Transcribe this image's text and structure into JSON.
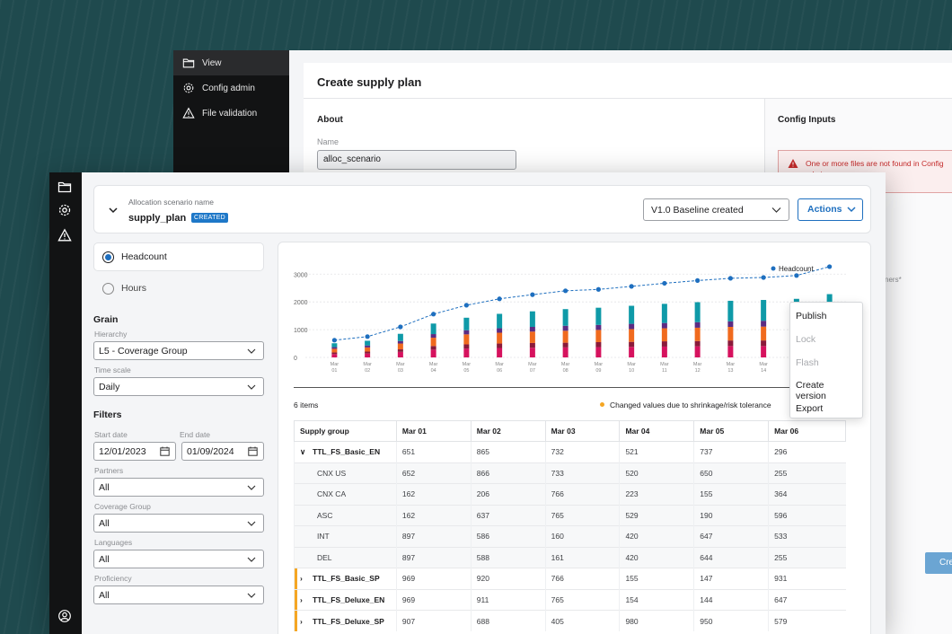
{
  "back_window": {
    "nav": [
      {
        "label": "View",
        "icon": "folder-icon",
        "active": true
      },
      {
        "label": "Config admin",
        "icon": "gear-icon",
        "active": false
      },
      {
        "label": "File validation",
        "icon": "warning-icon",
        "active": false
      }
    ],
    "title": "Create supply plan",
    "about": {
      "heading": "About",
      "name_label": "Name",
      "name_value": "alloc_scenario"
    },
    "config": {
      "heading": "Config Inputs",
      "alert_text": "One or more files are not found in Config admin.",
      "partners_fragment": "ners*",
      "create_button": "Cre"
    }
  },
  "header": {
    "scenario_label": "Allocation scenario name",
    "scenario_name": "supply_plan",
    "status_badge": "CREATED",
    "version_select": "V1.0 Baseline created",
    "actions_label": "Actions"
  },
  "mode": {
    "headcount": "Headcount",
    "hours": "Hours",
    "selected": "headcount"
  },
  "grain": {
    "title": "Grain",
    "hierarchy_label": "Hierarchy",
    "hierarchy_value": "L5 - Coverage Group",
    "time_scale_label": "Time scale",
    "time_scale_value": "Daily"
  },
  "filters": {
    "title": "Filters",
    "start_label": "Start date",
    "start_value": "12/01/2023",
    "end_label": "End date",
    "end_value": "01/09/2024",
    "partners_label": "Partners",
    "partners_value": "All",
    "coverage_label": "Coverage Group",
    "coverage_value": "All",
    "languages_label": "Languages",
    "languages_value": "All",
    "proficiency_label": "Proficiency",
    "proficiency_value": "All"
  },
  "chart_data": {
    "type": "bar",
    "categories": [
      "Mar 01",
      "Mar 02",
      "Mar 03",
      "Mar 04",
      "Mar 05",
      "Mar 06",
      "Mar 07",
      "Mar 08",
      "Mar 09",
      "Mar 10",
      "Mar 11",
      "Mar 12",
      "Mar 13",
      "Mar 14",
      "Mar 15",
      "Mar 16"
    ],
    "yticks": [
      0,
      1000,
      2000,
      3000
    ],
    "ylim": [
      0,
      3300
    ],
    "legend": "Headcount",
    "legend_position": "top-right",
    "line_series": {
      "name": "Headcount",
      "color": "#1e6fbf",
      "values": [
        620,
        750,
        1100,
        1560,
        1880,
        2110,
        2260,
        2400,
        2450,
        2560,
        2670,
        2770,
        2850,
        2880,
        2950,
        3270
      ]
    },
    "stack_colors": [
      "#d6125e",
      "#8a1a3a",
      "#f06a1e",
      "#5b2c83",
      "#0f9aa8"
    ],
    "stacks": [
      [
        120,
        60,
        130,
        60,
        140
      ],
      [
        140,
        70,
        150,
        70,
        170
      ],
      [
        200,
        90,
        210,
        90,
        260
      ],
      [
        280,
        130,
        300,
        130,
        380
      ],
      [
        320,
        150,
        360,
        150,
        450
      ],
      [
        340,
        160,
        390,
        160,
        520
      ],
      [
        350,
        170,
        410,
        170,
        560
      ],
      [
        360,
        170,
        430,
        180,
        600
      ],
      [
        370,
        180,
        440,
        180,
        620
      ],
      [
        380,
        180,
        460,
        190,
        650
      ],
      [
        390,
        190,
        470,
        190,
        690
      ],
      [
        400,
        190,
        480,
        200,
        720
      ],
      [
        410,
        200,
        490,
        200,
        740
      ],
      [
        410,
        200,
        500,
        210,
        750
      ],
      [
        420,
        200,
        510,
        210,
        770
      ],
      [
        430,
        210,
        520,
        220,
        900
      ]
    ],
    "grid": true
  },
  "table": {
    "items_count": "6 items",
    "changed_note": "Changed values due to shrinkage/risk tolerance",
    "columns": [
      "Supply group",
      "Mar 01",
      "Mar 02",
      "Mar 03",
      "Mar 04",
      "Mar 05",
      "Mar 06"
    ],
    "rows": [
      {
        "type": "group-open",
        "highlight": false,
        "cells": [
          "TTL_FS_Basic_EN",
          "651",
          "865",
          "732",
          "521",
          "737",
          "296"
        ]
      },
      {
        "type": "sub",
        "highlight": false,
        "cells": [
          "CNX US",
          "652",
          "866",
          "733",
          "520",
          "650",
          "255"
        ]
      },
      {
        "type": "sub",
        "highlight": false,
        "cells": [
          "CNX CA",
          "162",
          "206",
          "766",
          "223",
          "155",
          "364"
        ]
      },
      {
        "type": "sub",
        "highlight": false,
        "cells": [
          "ASC",
          "162",
          "637",
          "765",
          "529",
          "190",
          "596"
        ]
      },
      {
        "type": "sub",
        "highlight": false,
        "cells": [
          "INT",
          "897",
          "586",
          "160",
          "420",
          "647",
          "533"
        ]
      },
      {
        "type": "sub",
        "highlight": false,
        "cells": [
          "DEL",
          "897",
          "588",
          "161",
          "420",
          "644",
          "255"
        ]
      },
      {
        "type": "group",
        "highlight": true,
        "cells": [
          "TTL_FS_Basic_SP",
          "969",
          "920",
          "766",
          "155",
          "147",
          "931"
        ]
      },
      {
        "type": "group",
        "highlight": true,
        "cells": [
          "TTL_FS_Deluxe_EN",
          "969",
          "911",
          "765",
          "154",
          "144",
          "647"
        ]
      },
      {
        "type": "group",
        "highlight": true,
        "cells": [
          "TTL_FS_Deluxe_SP",
          "907",
          "688",
          "405",
          "980",
          "950",
          "579"
        ]
      }
    ]
  },
  "actions_menu": [
    {
      "label": "Publish",
      "disabled": false
    },
    {
      "label": "Lock",
      "disabled": true
    },
    {
      "label": "Flash",
      "disabled": true
    },
    {
      "label": "Create version",
      "disabled": false
    },
    {
      "label": "Export",
      "disabled": false
    }
  ]
}
